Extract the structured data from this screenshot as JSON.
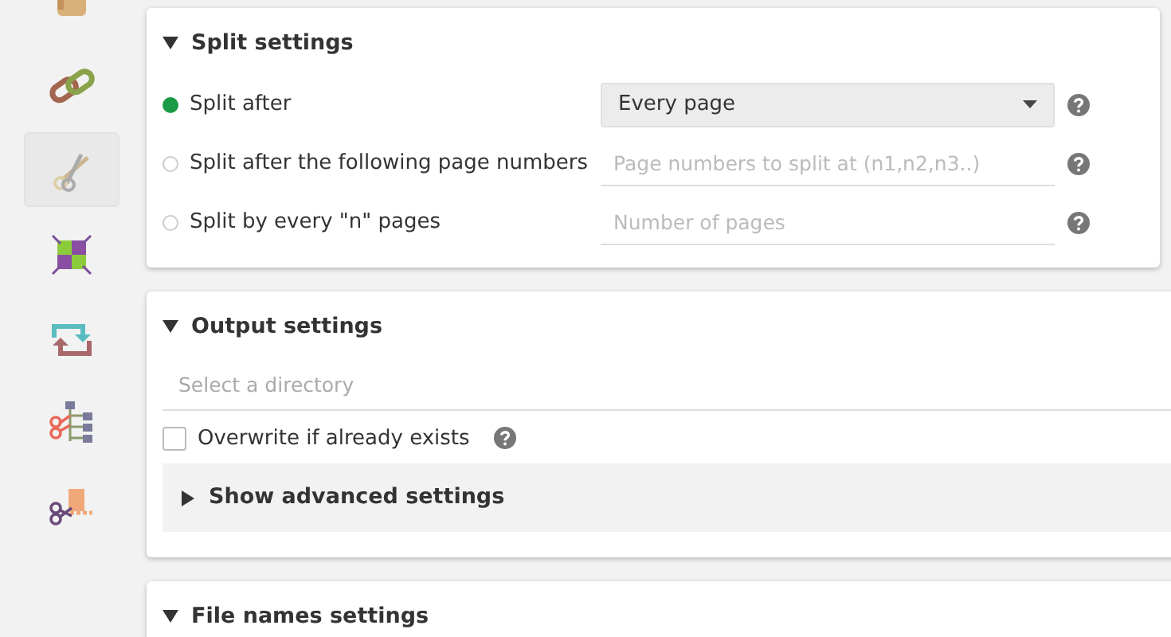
{
  "sidebar": {
    "items": [
      {
        "kind": "hand",
        "selected": false
      },
      {
        "kind": "chain",
        "selected": false
      },
      {
        "kind": "scissors",
        "selected": true
      },
      {
        "kind": "squares",
        "selected": false
      },
      {
        "kind": "rotate",
        "selected": false
      },
      {
        "kind": "tree",
        "selected": false
      },
      {
        "kind": "size",
        "selected": false
      }
    ]
  },
  "split_settings": {
    "title": "Split settings",
    "expanded": true,
    "options": [
      {
        "label": "Split after",
        "selected": true,
        "kind": "select",
        "value": "Every page"
      },
      {
        "label": "Split after the following page numbers",
        "selected": false,
        "kind": "input",
        "placeholder": "Page numbers to split at (n1,n2,n3..)"
      },
      {
        "label": "Split by every \"n\" pages",
        "selected": false,
        "kind": "input",
        "placeholder": "Number of pages"
      }
    ]
  },
  "output_settings": {
    "title": "Output settings",
    "expanded": true,
    "directory": {
      "placeholder": "Select a directory"
    },
    "overwrite": {
      "label": "Overwrite if already exists",
      "checked": false
    },
    "advanced": {
      "label": "Show advanced settings",
      "expanded": false
    }
  },
  "file_names_settings": {
    "title": "File names settings",
    "expanded": true
  }
}
